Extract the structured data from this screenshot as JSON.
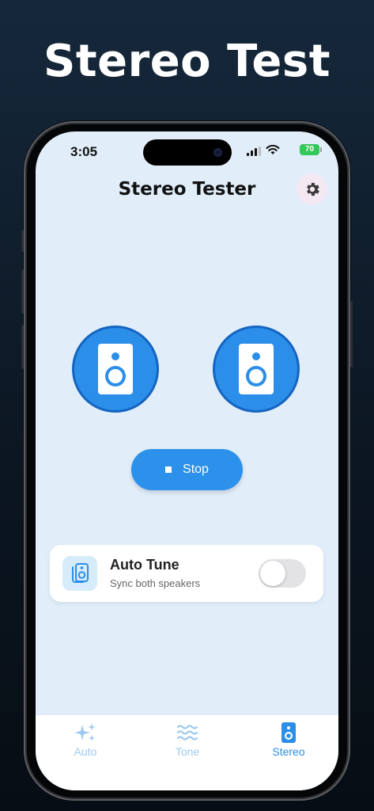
{
  "headline": "Stereo Test",
  "status": {
    "time": "3:05",
    "battery": "70"
  },
  "app": {
    "title": "Stereo Tester",
    "settings_icon": "gear-icon"
  },
  "speakers": [
    {
      "name": "left",
      "icon": "speaker-icon",
      "color": "#2b8ee8"
    },
    {
      "name": "right",
      "icon": "speaker-icon",
      "color": "#2b8ee8"
    }
  ],
  "stop_button": {
    "label": "Stop",
    "icon": "stop-icon"
  },
  "auto_tune": {
    "title": "Auto Tune",
    "subtitle": "Sync both speakers",
    "enabled": false
  },
  "tabs": [
    {
      "label": "Auto",
      "icon": "sparkles-icon",
      "active": false
    },
    {
      "label": "Tone",
      "icon": "waves-icon",
      "active": false
    },
    {
      "label": "Stereo",
      "icon": "speaker-icon",
      "active": true
    }
  ],
  "colors": {
    "accent": "#2b91ea",
    "tab_inactive": "#9cc9ef",
    "tab_active": "#2b8ee8"
  }
}
